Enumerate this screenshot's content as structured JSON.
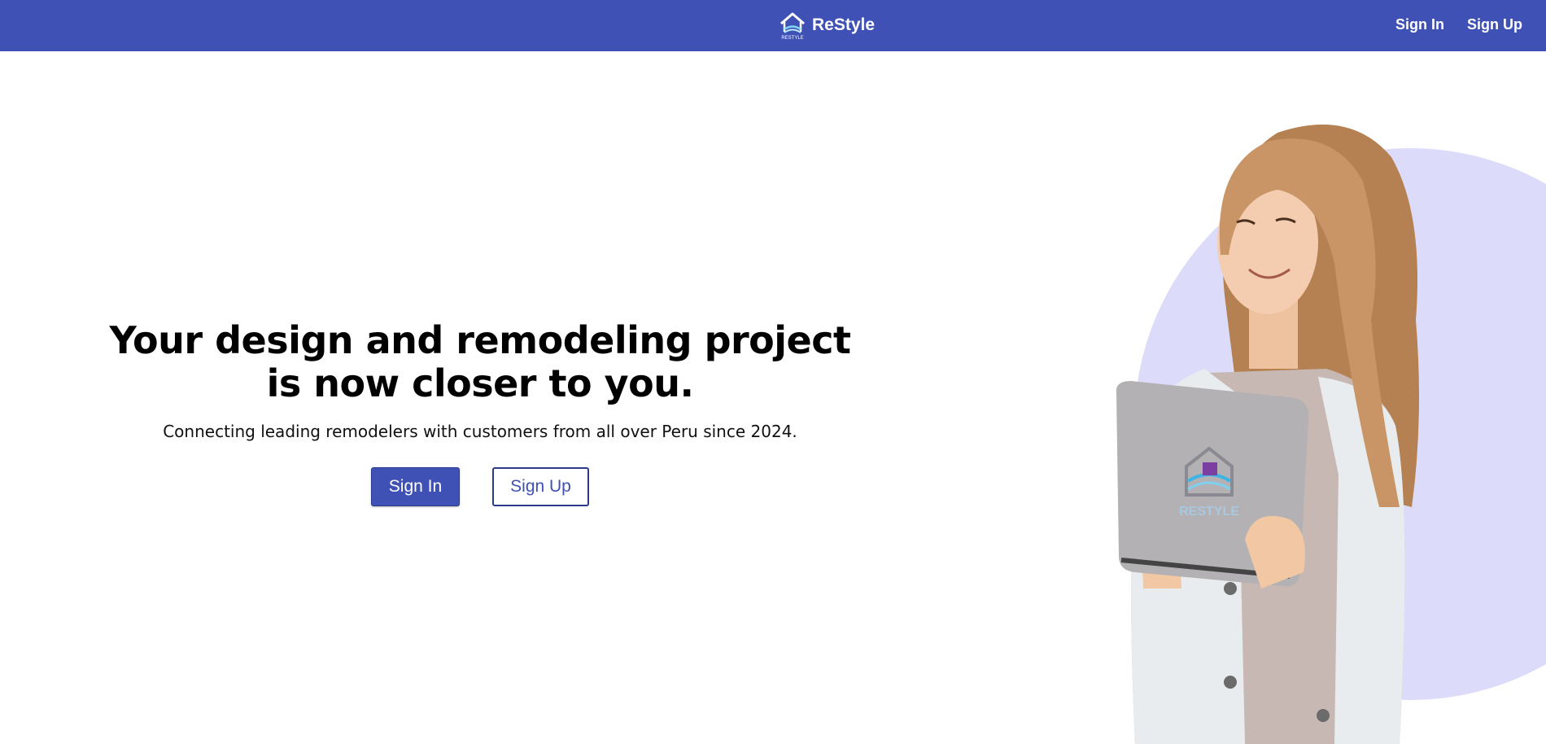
{
  "header": {
    "brand_name": "ReStyle",
    "brand_logo_icon": "house-wave-logo-icon",
    "logo_caption": "RESTYLE",
    "nav": {
      "sign_in": "Sign In",
      "sign_up": "Sign Up"
    }
  },
  "hero": {
    "title": "Your design and remodeling project is now closer to you.",
    "subtitle": "Connecting leading remodelers with customers from all over Peru since 2024.",
    "primary_button": "Sign In",
    "secondary_button": "Sign Up",
    "tablet_logo_text": "RESTYLE"
  },
  "colors": {
    "primary": "#3f51b5",
    "circle": "#dcdcfa",
    "text": "#000000",
    "background": "#ffffff"
  }
}
